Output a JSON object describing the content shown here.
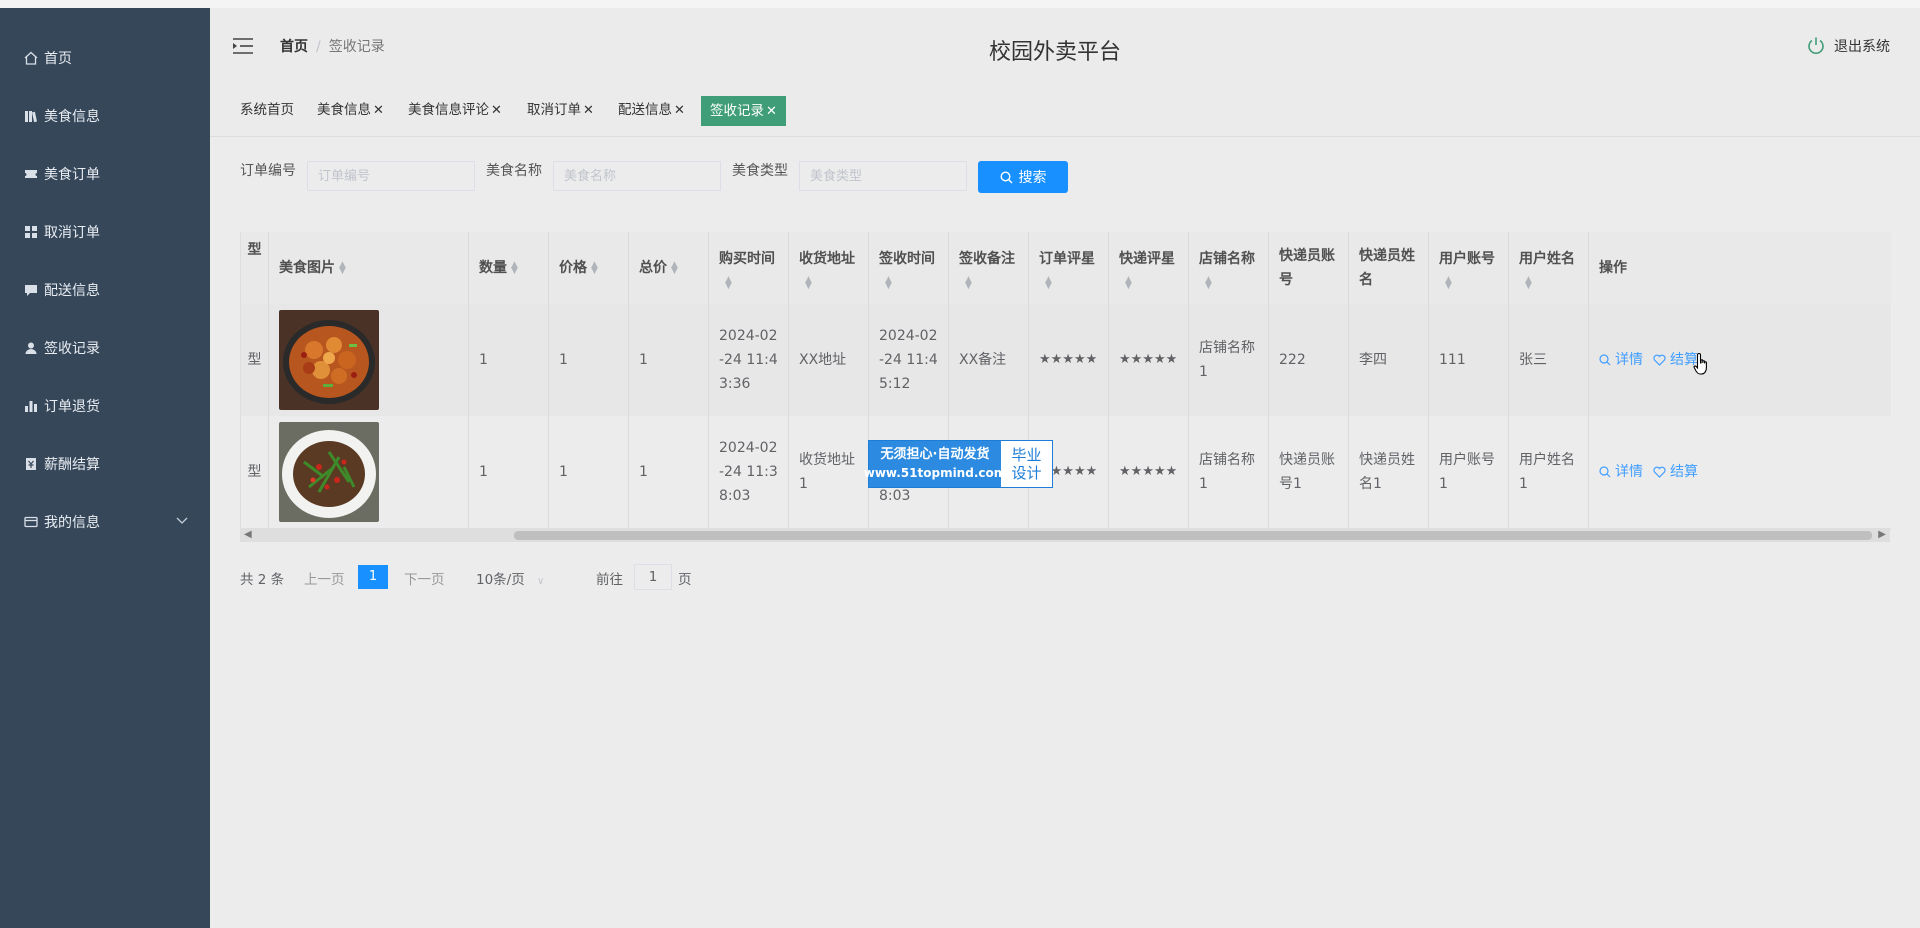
{
  "app": {
    "title": "校园外卖平台",
    "logout": "退出系统"
  },
  "breadcrumb": {
    "home": "首页",
    "separator": "/",
    "current": "签收记录"
  },
  "sidebar": {
    "items": [
      {
        "label": "首页",
        "icon": "home-icon"
      },
      {
        "label": "美食信息",
        "icon": "books-icon"
      },
      {
        "label": "美食订单",
        "icon": "ticket-icon"
      },
      {
        "label": "取消订单",
        "icon": "grid-icon"
      },
      {
        "label": "配送信息",
        "icon": "chat-icon"
      },
      {
        "label": "签收记录",
        "icon": "user-icon"
      },
      {
        "label": "订单退货",
        "icon": "bar-chart-icon"
      },
      {
        "label": "薪酬结算",
        "icon": "ledger-icon"
      },
      {
        "label": "我的信息",
        "icon": "card-icon"
      }
    ]
  },
  "tags": [
    {
      "label": "系统首页",
      "closable": false,
      "active": false
    },
    {
      "label": "美食信息",
      "closable": true,
      "active": false
    },
    {
      "label": "美食信息评论",
      "closable": true,
      "active": false
    },
    {
      "label": "取消订单",
      "closable": true,
      "active": false
    },
    {
      "label": "配送信息",
      "closable": true,
      "active": false
    },
    {
      "label": "签收记录",
      "closable": true,
      "active": true
    }
  ],
  "tag_close": "✕",
  "search": {
    "fields": [
      {
        "label": "订单编号",
        "placeholder": "订单编号",
        "value": ""
      },
      {
        "label": "美食名称",
        "placeholder": "美食名称",
        "value": ""
      },
      {
        "label": "美食类型",
        "placeholder": "美食类型",
        "value": ""
      }
    ],
    "button": "搜索"
  },
  "table": {
    "columns": [
      "型",
      "美食图片",
      "数量",
      "价格",
      "总价",
      "购买时间",
      "收货地址",
      "签收时间",
      "签收备注",
      "订单评星",
      "快递评星",
      "店铺名称",
      "快递员账号",
      "快递员姓名",
      "用户账号",
      "用户姓名",
      "操作"
    ],
    "rows": [
      {
        "type": "型",
        "image": "food-1",
        "qty": "1",
        "price": "1",
        "total": "1",
        "buy_time": "2024-02-24 11:43:36",
        "address": "XX地址",
        "sign_time": "2024-02-24 11:45:12",
        "note": "XX备注",
        "order_stars": "★★★★★",
        "courier_stars": "★★★★★",
        "shop": "店铺名称1",
        "courier_account": "222",
        "courier_name": "李四",
        "user_account": "111",
        "user_name": "张三"
      },
      {
        "type": "型",
        "image": "food-2",
        "qty": "1",
        "price": "1",
        "total": "1",
        "buy_time": "2024-02-24 11:38:03",
        "address": "收货地址1",
        "sign_time": "2024-02-24 11:38:03",
        "note": "",
        "order_stars": "★★★★★",
        "courier_stars": "★★★★★",
        "shop": "店铺名称1",
        "courier_account": "快递员账号1",
        "courier_name": "快递员姓名1",
        "user_account": "用户账号1",
        "user_name": "用户姓名1"
      }
    ],
    "actions": {
      "detail": "详情",
      "settle": "结算"
    }
  },
  "pagination": {
    "total": "共 2 条",
    "prev": "上一页",
    "current": "1",
    "next": "下一页",
    "page_size": "10条/页",
    "goto_prefix": "前往",
    "goto_value": "1",
    "goto_suffix": "页"
  },
  "watermark": {
    "line1": "无须担心·自动发货",
    "line2": "www.51topmind.com",
    "right1": "毕业",
    "right2": "设计"
  },
  "colors": {
    "sidebar": "#36475a",
    "primary": "#1890ff",
    "active_tag": "#3f9d78",
    "link": "#409eff"
  }
}
